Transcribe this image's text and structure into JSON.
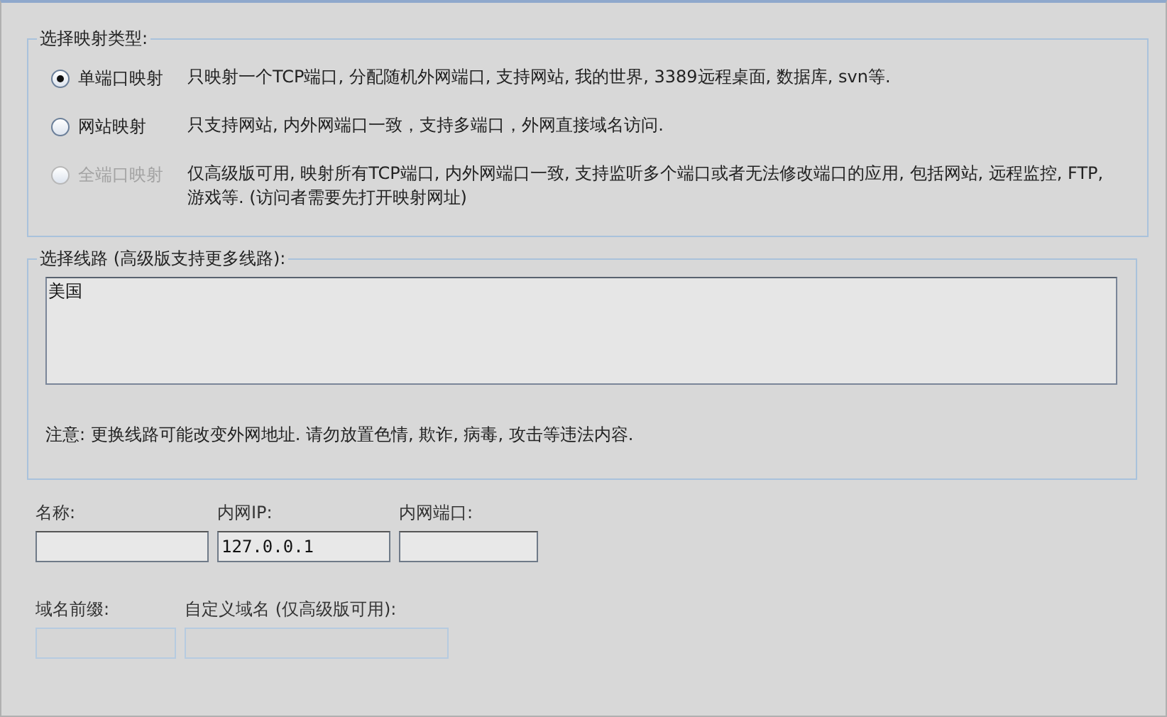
{
  "mapping_type": {
    "legend": "选择映射类型:",
    "options": [
      {
        "label": "单端口映射",
        "description": "只映射一个TCP端口, 分配随机外网端口, 支持网站, 我的世界, 3389远程桌面, 数据库, svn等.",
        "selected": true,
        "disabled": false
      },
      {
        "label": "网站映射",
        "description": "只支持网站, 内外网端口一致，支持多端口，外网直接域名访问.",
        "selected": false,
        "disabled": false
      },
      {
        "label": "全端口映射",
        "description": "仅高级版可用, 映射所有TCP端口, 内外网端口一致, 支持监听多个端口或者无法修改端口的应用, 包括网站, 远程监控, FTP, 游戏等. (访问者需要先打开映射网址)",
        "selected": false,
        "disabled": true
      }
    ]
  },
  "line": {
    "legend": "选择线路 (高级版支持更多线路):",
    "items": [
      "美国"
    ],
    "note": "注意: 更换线路可能改变外网地址. 请勿放置色情, 欺诈, 病毒, 攻击等违法内容."
  },
  "field_rows": [
    [
      {
        "label": "名称:",
        "disabled": false
      },
      {
        "label": "内网IP:",
        "value": "127.0.0.1",
        "disabled": false
      },
      {
        "label": "内网端口:",
        "disabled": false
      }
    ],
    [
      {
        "label": "域名前缀:",
        "disabled": true
      },
      {
        "label": "自定义域名 (仅高级版可用):",
        "disabled": true
      }
    ]
  ]
}
